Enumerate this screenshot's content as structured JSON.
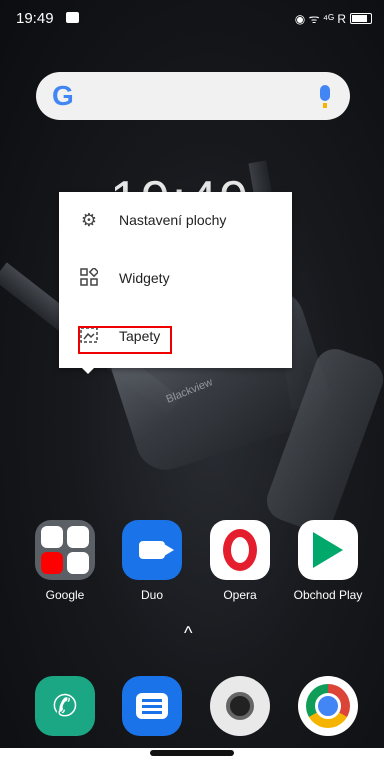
{
  "status_bar": {
    "time": "19:49",
    "icons": "◉ ᯤ ⁴ᴳ R"
  },
  "search_bar": {
    "logo": "G",
    "icons": [
      "google-logo",
      "mic-icon"
    ]
  },
  "wallpaper": {
    "clock": "19:49",
    "brand": "Blackview"
  },
  "context_menu": {
    "items": [
      {
        "label": "Nastavení plochy",
        "icon": "gear-icon"
      },
      {
        "label": "Widgety",
        "icon": "widgets-icon"
      },
      {
        "label": "Tapety",
        "icon": "wallpaper-icon"
      }
    ]
  },
  "apps": [
    {
      "label": "Google"
    },
    {
      "label": "Duo"
    },
    {
      "label": "Opera"
    },
    {
      "label": "Obchod Play"
    }
  ],
  "dock": {
    "icons": [
      "phone-icon",
      "messages-icon",
      "camera-icon",
      "chrome-icon"
    ],
    "drawer_chevron": "^"
  },
  "colors": {
    "highlight": "#e00000",
    "google_blue": "#4285f4",
    "duo_blue": "#1a73e8",
    "opera_red": "#e41e2d",
    "phone_green": "#1ba784"
  }
}
